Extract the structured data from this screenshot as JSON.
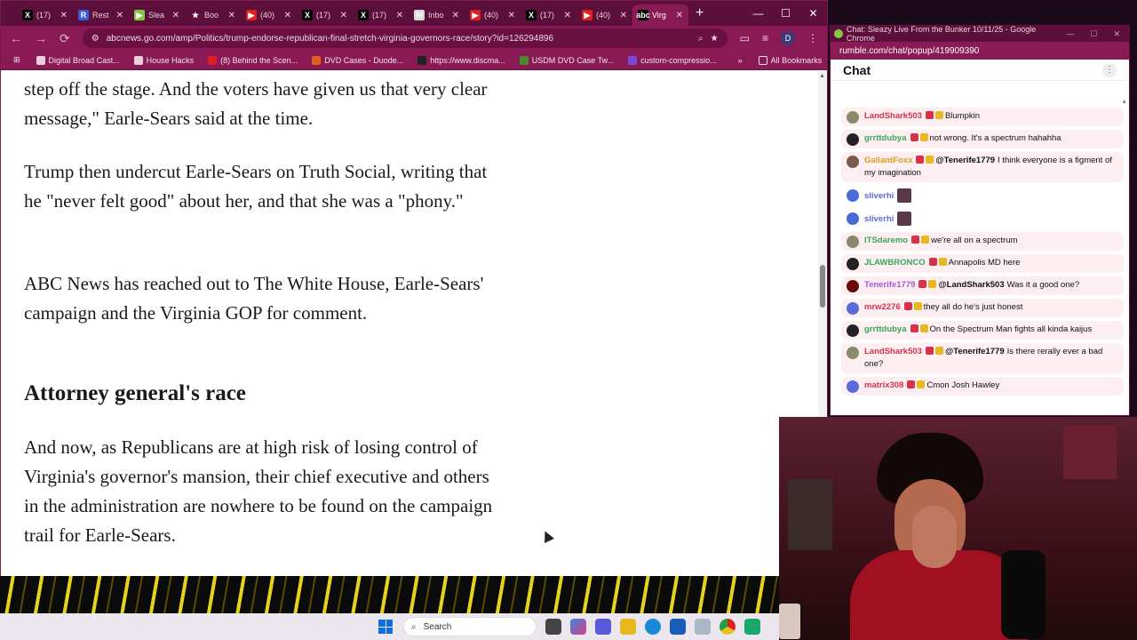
{
  "browser": {
    "tabs": [
      {
        "icon": "x-icon",
        "glyph": "X",
        "color": "#000000",
        "label": "(17)"
      },
      {
        "icon": "r-icon",
        "glyph": "R",
        "color": "#3a5ad8",
        "label": "Rest"
      },
      {
        "icon": "rumble-icon",
        "glyph": "▶",
        "color": "#85c742",
        "label": "Slea"
      },
      {
        "icon": "star-icon",
        "glyph": "★",
        "color": "#5c0f3a",
        "label": "Boo"
      },
      {
        "icon": "youtube-icon",
        "glyph": "▶",
        "color": "#e02020",
        "label": "(40)"
      },
      {
        "icon": "x-icon",
        "glyph": "X",
        "color": "#000000",
        "label": "(17)"
      },
      {
        "icon": "x-icon",
        "glyph": "X",
        "color": "#000000",
        "label": "(17)"
      },
      {
        "icon": "gmail-icon",
        "glyph": "M",
        "color": "#d8d8d8",
        "label": "Inbo"
      },
      {
        "icon": "youtube-icon",
        "glyph": "▶",
        "color": "#e02020",
        "label": "(40)"
      },
      {
        "icon": "x-icon",
        "glyph": "X",
        "color": "#000000",
        "label": "(17)"
      },
      {
        "icon": "youtube-icon",
        "glyph": "▶",
        "color": "#e02020",
        "label": "(40)"
      },
      {
        "icon": "abc-icon",
        "glyph": "abc",
        "color": "#000000",
        "label": "Virg",
        "active": true
      }
    ],
    "url": "abcnews.go.com/amp/Politics/trump-endorse-republican-final-stretch-virginia-governors-race/story?id=126294896",
    "profile_initial": "D",
    "bookmarks": [
      {
        "label": "Digital Broad Cast...",
        "color": "#e8d0dc"
      },
      {
        "label": "House Hacks",
        "color": "#e8d0dc"
      },
      {
        "label": "(8) Behind the Scen...",
        "color": "#e02020"
      },
      {
        "label": "DVD Cases - Duode...",
        "color": "#e06020"
      },
      {
        "label": "https://www.discma...",
        "color": "#222222"
      },
      {
        "label": "USDM DVD Case Tw...",
        "color": "#4a8a2a"
      },
      {
        "label": "custom-compressio...",
        "color": "#7a4ad8"
      }
    ],
    "all_bookmarks": "All Bookmarks"
  },
  "article": {
    "p1": "step off the stage. And the voters have given us that very clear message,\" Earle-Sears said at the time.",
    "p2": "Trump then undercut Earle-Sears on Truth Social, writing that he \"never felt good\" about her, and that she was a \"phony.\"",
    "p3": "ABC News has reached out to The White House, Earle-Sears' campaign and the Virginia GOP for comment.",
    "heading": "Attorney general's race",
    "p4": "And now, as Republicans are at high risk of losing control of Virginia's governor's mansion, their chief executive and others in the administration are nowhere to be found on the campaign trail for Earle-Sears."
  },
  "chat": {
    "window_title": "Chat: Sleazy Live From the Bunker 10/11/25 - Google Chrome",
    "url": "rumble.com/chat/popup/419909390",
    "header": "Chat",
    "messages": [
      {
        "user": "LandShark503",
        "color": "#d8324a",
        "avatar_color": "#8a8a6a",
        "mention": "",
        "text": "Blumpkin"
      },
      {
        "user": "grrttdubya",
        "color": "#3aa85a",
        "avatar_color": "#222222",
        "mention": "",
        "text": "not wrong. It's a spectrum hahahha"
      },
      {
        "user": "GallantFoxx",
        "color": "#d8a020",
        "avatar_color": "#7a5a4a",
        "mention": "@Tenerife1779",
        "text": "I think everyone is a figment of my imagination"
      },
      {
        "user": "sliverhi",
        "color": "#5a6ad8",
        "avatar_color": "#4a6ad8",
        "mention": "",
        "text": "",
        "plain": true
      },
      {
        "user": "sliverhi",
        "color": "#5a6ad8",
        "avatar_color": "#4a6ad8",
        "mention": "",
        "text": "",
        "plain": true
      },
      {
        "user": "ITSdaremo",
        "color": "#3aa85a",
        "avatar_color": "#8a8a6a",
        "mention": "",
        "text": "we're all on a spectrum"
      },
      {
        "user": "JLAWBRONCO",
        "color": "#3aa85a",
        "avatar_color": "#222222",
        "mention": "",
        "text": "Annapolis MD here"
      },
      {
        "user": "Tenerife1779",
        "color": "#a05ad8",
        "avatar_color": "#6a0a0a",
        "mention": "@LandShark503",
        "text": "Was it a good one?"
      },
      {
        "user": "mrw2276",
        "color": "#d8324a",
        "avatar_color": "#5a6ad8",
        "mention": "",
        "text": "they all do he's just honest"
      },
      {
        "user": "grrttdubya",
        "color": "#3aa85a",
        "avatar_color": "#222222",
        "mention": "",
        "text": "On the Spectrum Man fights all kinda kaijus"
      },
      {
        "user": "LandShark503",
        "color": "#d8324a",
        "avatar_color": "#8a8a6a",
        "mention": "@Tenerife1779",
        "text": "Is there rerally ever a bad one?"
      },
      {
        "user": "matrix308",
        "color": "#d8324a",
        "avatar_color": "#5a6ad8",
        "mention": "",
        "text": "Cmon Josh Hawley"
      }
    ]
  },
  "taskbar": {
    "search_placeholder": "Search"
  }
}
